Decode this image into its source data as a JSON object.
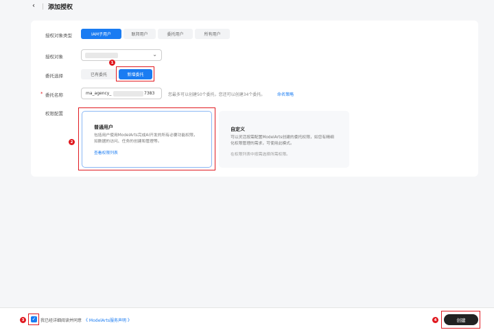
{
  "header": {
    "back_icon": "chevron-left",
    "title": "添加授权"
  },
  "form": {
    "type_label": "授权对象类型",
    "type_options": [
      "IAM子用户",
      "联邦用户",
      "委托用户",
      "所有用户"
    ],
    "type_selected": "IAM子用户",
    "object_label": "授权对象",
    "delegation_label": "委托选择",
    "delegation_options": [
      "已有委托",
      "新增委托"
    ],
    "delegation_selected": "新增委托",
    "name_label": "委托名称",
    "name_prefix": "ma_agency_",
    "name_suffix": "7383",
    "name_hint": "您最多可以创建50个委托，您还可以创建34个委托。",
    "name_link": "命名策略",
    "perm_label": "权限配置",
    "perm_cards": [
      {
        "title": "普通用户",
        "desc": "包括用户使用ModelArts完成AI开发的所有必要功能权限，如数据的访问、任务的创建和管理等。",
        "link": "查看权限列表"
      },
      {
        "title": "自定义",
        "desc": "可以灵活按需配置ModelArts创建的委托权限，如您有精细化权限管理的需求，可使用此模式。",
        "note": "在权限列表中按需选择所需权限。"
      }
    ]
  },
  "footer": {
    "agree_text": "我已经详细阅读并同意",
    "agree_link": "《 ModelArts服务声明 》",
    "create_label": "创建",
    "checked": true
  },
  "badges": [
    "1",
    "2",
    "3",
    "4"
  ],
  "colors": {
    "primary": "#1a7cf2",
    "annotation": "#e0181f"
  }
}
